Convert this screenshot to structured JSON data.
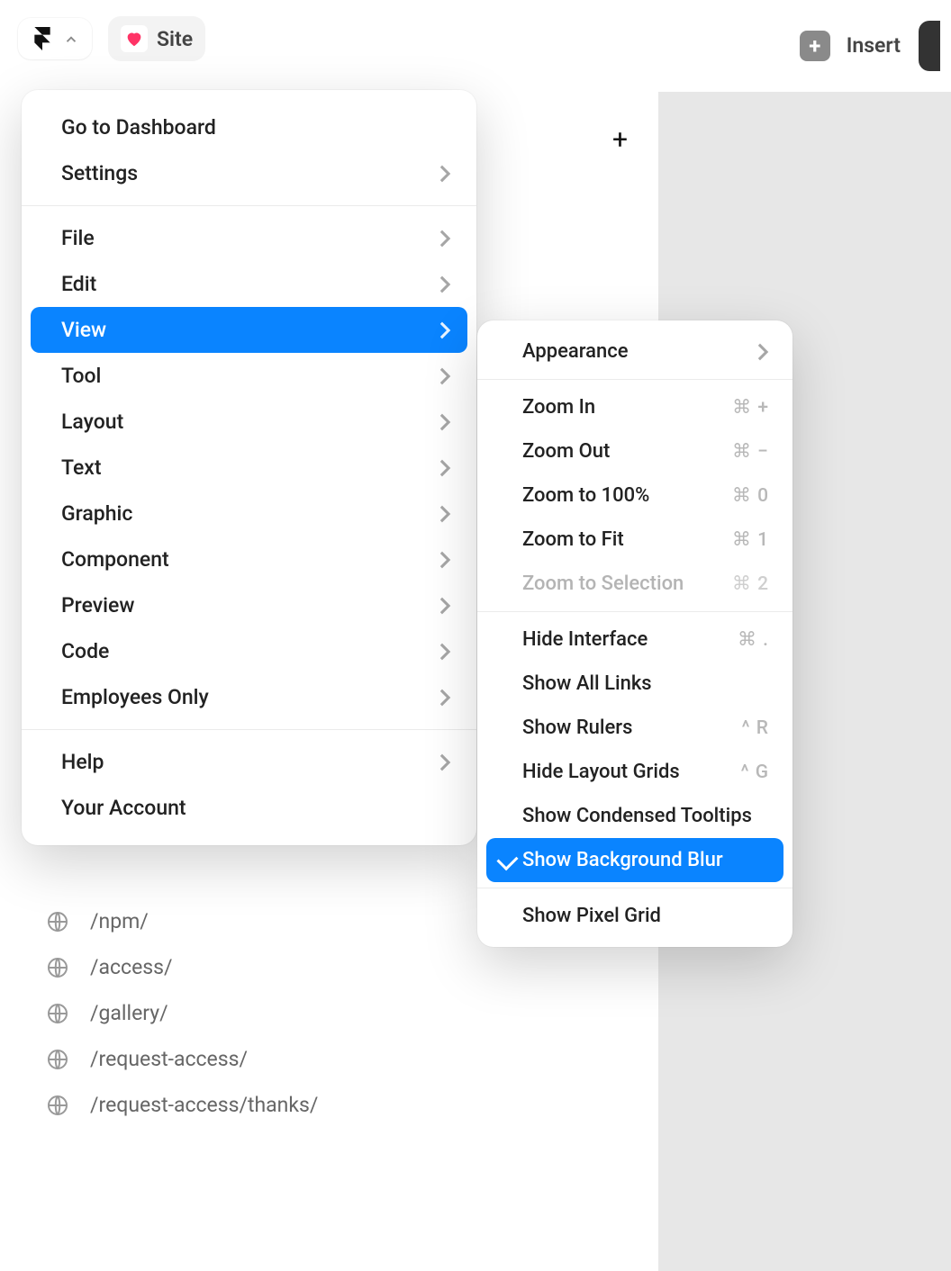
{
  "toolbar": {
    "site_label": "Site",
    "insert_label": "Insert"
  },
  "menu": {
    "dashboard": "Go to Dashboard",
    "settings": "Settings",
    "file": "File",
    "edit": "Edit",
    "view": "View",
    "tool": "Tool",
    "layout": "Layout",
    "text": "Text",
    "graphic": "Graphic",
    "component": "Component",
    "preview": "Preview",
    "code": "Code",
    "employees": "Employees Only",
    "help": "Help",
    "account": "Your Account"
  },
  "submenu": {
    "appearance": "Appearance",
    "zoom_in": {
      "label": "Zoom In",
      "shortcut": "⌘ +"
    },
    "zoom_out": {
      "label": "Zoom Out",
      "shortcut": "⌘ −"
    },
    "zoom_100": {
      "label": "Zoom to 100%",
      "shortcut": "⌘ 0"
    },
    "zoom_fit": {
      "label": "Zoom to Fit",
      "shortcut": "⌘ 1"
    },
    "zoom_sel": {
      "label": "Zoom to Selection",
      "shortcut": "⌘ 2"
    },
    "hide_interface": {
      "label": "Hide Interface",
      "shortcut": "⌘ ."
    },
    "show_links": "Show All Links",
    "show_rulers": {
      "label": "Show Rulers",
      "shortcut": "^ R"
    },
    "hide_grids": {
      "label": "Hide Layout Grids",
      "shortcut": "^ G"
    },
    "condensed_tooltips": "Show Condensed Tooltips",
    "background_blur": "Show Background Blur",
    "pixel_grid": "Show Pixel Grid"
  },
  "pages": [
    "/npm/",
    "/access/",
    "/gallery/",
    "/request-access/",
    "/request-access/thanks/"
  ]
}
